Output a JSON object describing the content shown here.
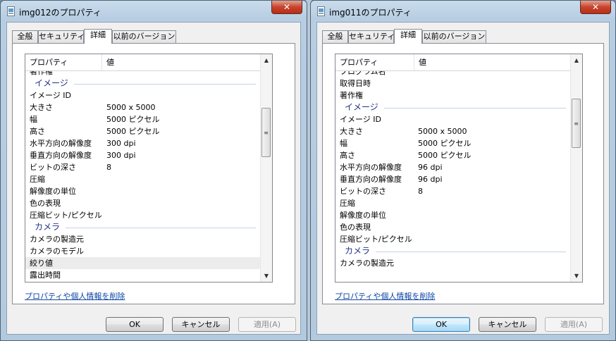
{
  "windows": [
    {
      "title": "img012のプロパティ",
      "tabs": [
        "全般",
        "セキュリティ",
        "詳細",
        "以前のバージョン"
      ],
      "active_tab": 2,
      "columns": {
        "name": "プロパティ",
        "value": "値"
      },
      "rows": [
        {
          "name": "著作権",
          "value": "",
          "partial": true
        },
        {
          "group": true,
          "name": "イメージ"
        },
        {
          "name": "イメージ ID",
          "value": ""
        },
        {
          "name": "大きさ",
          "value": "5000 x 5000"
        },
        {
          "name": "幅",
          "value": "5000 ピクセル"
        },
        {
          "name": "高さ",
          "value": "5000 ピクセル"
        },
        {
          "name": "水平方向の解像度",
          "value": "300 dpi"
        },
        {
          "name": "垂直方向の解像度",
          "value": "300 dpi"
        },
        {
          "name": "ビットの深さ",
          "value": "8"
        },
        {
          "name": "圧縮",
          "value": ""
        },
        {
          "name": "解像度の単位",
          "value": ""
        },
        {
          "name": "色の表現",
          "value": ""
        },
        {
          "name": "圧縮ビット/ピクセル",
          "value": ""
        },
        {
          "group": true,
          "name": "カメラ"
        },
        {
          "name": "カメラの製造元",
          "value": ""
        },
        {
          "name": "カメラのモデル",
          "value": ""
        },
        {
          "name": "絞り値",
          "value": "",
          "selected": true
        },
        {
          "name": "露出時間",
          "value": "",
          "partial": true
        }
      ],
      "remove_link": "プロパティや個人情報を削除",
      "buttons": {
        "ok": "OK",
        "cancel": "キャンセル",
        "apply": "適用(A)"
      },
      "scroll_thumb": 0.27
    },
    {
      "title": "img011のプロパティ",
      "tabs": [
        "全般",
        "セキュリティ",
        "詳細",
        "以前のバージョン"
      ],
      "active_tab": 2,
      "columns": {
        "name": "プロパティ",
        "value": "値"
      },
      "rows": [
        {
          "name": "プログラム名",
          "value": "",
          "partial": true
        },
        {
          "name": "取得日時",
          "value": ""
        },
        {
          "name": "著作権",
          "value": ""
        },
        {
          "group": true,
          "name": "イメージ"
        },
        {
          "name": "イメージ ID",
          "value": ""
        },
        {
          "name": "大きさ",
          "value": "5000 x 5000"
        },
        {
          "name": "幅",
          "value": "5000 ピクセル"
        },
        {
          "name": "高さ",
          "value": "5000 ピクセル"
        },
        {
          "name": "水平方向の解像度",
          "value": "96 dpi"
        },
        {
          "name": "垂直方向の解像度",
          "value": "96 dpi"
        },
        {
          "name": "ビットの深さ",
          "value": "8"
        },
        {
          "name": "圧縮",
          "value": ""
        },
        {
          "name": "解像度の単位",
          "value": ""
        },
        {
          "name": "色の表現",
          "value": ""
        },
        {
          "name": "圧縮ビット/ピクセル",
          "value": ""
        },
        {
          "group": true,
          "name": "カメラ"
        },
        {
          "name": "カメラの製造元",
          "value": ""
        }
      ],
      "remove_link": "プロパティや個人情報を削除",
      "buttons": {
        "ok": "OK",
        "cancel": "キャンセル",
        "apply": "適用(A)"
      },
      "scroll_thumb": 0.21
    }
  ],
  "icons": {
    "close": "close-icon",
    "file": "image-file-icon",
    "grip": "scroll-grip-icon"
  }
}
